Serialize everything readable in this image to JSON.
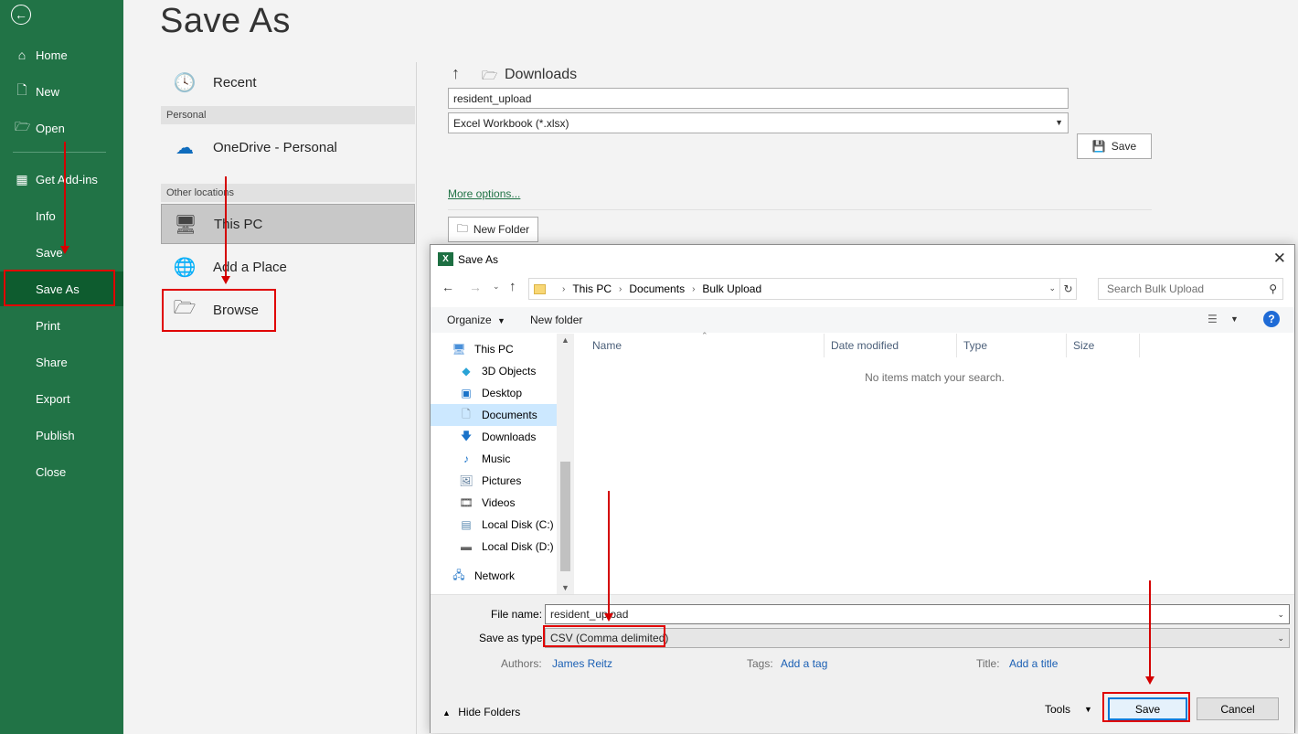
{
  "page_title": "Save As",
  "nav": {
    "items": [
      {
        "label": "Home",
        "icon": "home-icon"
      },
      {
        "label": "New",
        "icon": "new-doc-icon"
      },
      {
        "label": "Open",
        "icon": "open-folder-icon"
      },
      {
        "label": "Get Add-ins",
        "icon": "addins-icon"
      },
      {
        "label": "Info"
      },
      {
        "label": "Save"
      },
      {
        "label": "Save As"
      },
      {
        "label": "Print"
      },
      {
        "label": "Share"
      },
      {
        "label": "Export"
      },
      {
        "label": "Publish"
      },
      {
        "label": "Close"
      }
    ],
    "active": "Save As"
  },
  "locations": {
    "recent": "Recent",
    "personal_header": "Personal",
    "onedrive": "OneDrive - Personal",
    "other_header": "Other locations",
    "this_pc": "This PC",
    "add_place": "Add a Place",
    "browse": "Browse"
  },
  "right_panel": {
    "path": "Downloads",
    "filename": "resident_upload",
    "filetype": "Excel Workbook (*.xlsx)",
    "save_label": "Save",
    "more_options": "More options...",
    "new_folder": "New Folder"
  },
  "dialog": {
    "title": "Save As",
    "breadcrumb": [
      "This PC",
      "Documents",
      "Bulk Upload"
    ],
    "search_placeholder": "Search Bulk Upload",
    "organize": "Organize",
    "new_folder": "New folder",
    "tree": [
      "This PC",
      "3D Objects",
      "Desktop",
      "Documents",
      "Downloads",
      "Music",
      "Pictures",
      "Videos",
      "Local Disk (C:)",
      "Local Disk (D:)",
      "Network"
    ],
    "selected_tree_item": "Documents",
    "columns": [
      "Name",
      "Date modified",
      "Type",
      "Size"
    ],
    "empty_message": "No items match your search.",
    "file_name_label": "File name:",
    "file_name": "resident_upload",
    "save_type_label": "Save as type:",
    "save_type": "CSV (Comma delimited)",
    "authors_label": "Authors:",
    "authors_value": "James Reitz",
    "tags_label": "Tags:",
    "tags_value": "Add a tag",
    "title_label": "Title:",
    "title_value": "Add a title",
    "hide_folders": "Hide Folders",
    "tools": "Tools",
    "save": "Save",
    "cancel": "Cancel"
  },
  "colors": {
    "nav_bg": "#217346",
    "nav_active": "#0e5c2f",
    "annotation_red": "#e00000",
    "link_blue": "#1a5fb4"
  }
}
